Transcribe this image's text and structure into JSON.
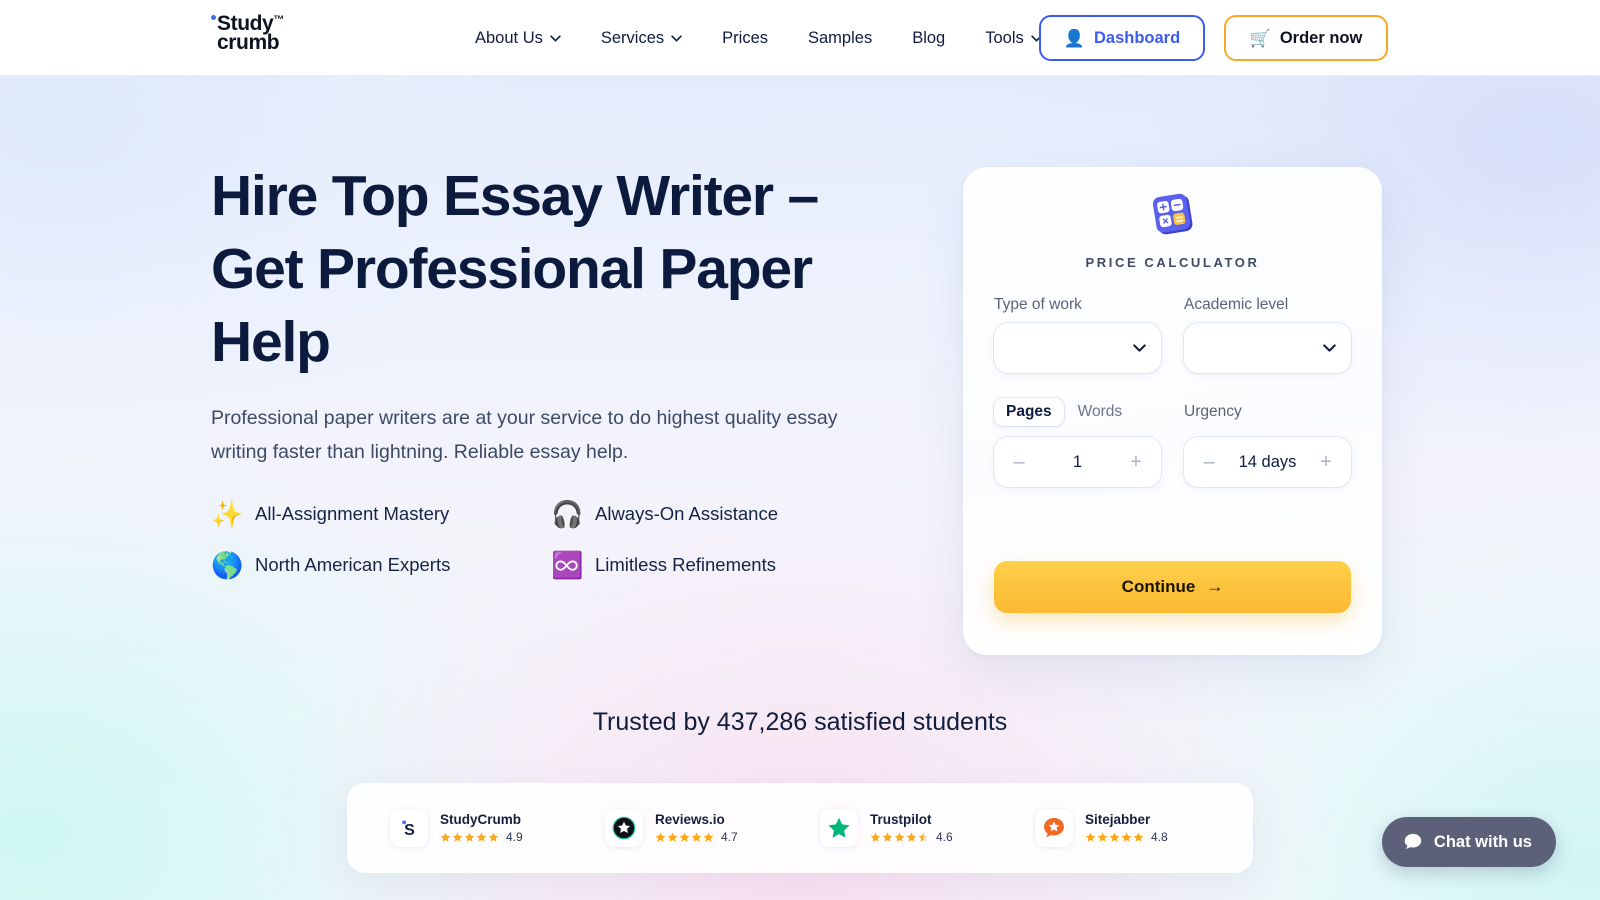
{
  "header": {
    "logo": {
      "line1": "Study",
      "tm": "™",
      "line2": "crumb"
    },
    "nav": [
      {
        "label": "About Us",
        "caret": true
      },
      {
        "label": "Services",
        "caret": true
      },
      {
        "label": "Prices",
        "caret": false
      },
      {
        "label": "Samples",
        "caret": false
      },
      {
        "label": "Blog",
        "caret": false
      },
      {
        "label": "Tools",
        "caret": true
      }
    ],
    "dashboard_button": {
      "label": "Dashboard",
      "icon": "user-icon",
      "glyph": "👤",
      "accent": "#3b5bf5"
    },
    "order_button": {
      "label": "Order now",
      "icon": "shopping-cart-icon",
      "glyph": "🛒",
      "accent": "#f9a825"
    }
  },
  "hero": {
    "heading": "Hire Top Essay Writer – Get Professional Paper Help",
    "paragraph": "Professional paper writers are at your service to do highest quality essay writing faster than lightning. Reliable essay help.",
    "features": [
      {
        "glyph": "✨",
        "icon": "sparkles-icon",
        "label": "All-Assignment Mastery"
      },
      {
        "glyph": "🎧",
        "icon": "headphones-icon",
        "label": "Always-On Assistance"
      },
      {
        "glyph": "🌎",
        "icon": "globe-americas-icon",
        "label": "North American Experts"
      },
      {
        "glyph": "♾️",
        "icon": "infinity-icon",
        "label": "Limitless Refinements"
      }
    ]
  },
  "calculator": {
    "icon": "calculator-icon",
    "title": "PRICE CALCULATOR",
    "type_of_work": {
      "label": "Type of work",
      "value": "",
      "placeholder": ""
    },
    "academic_level": {
      "label": "Academic level",
      "value": "",
      "placeholder": ""
    },
    "unit_tabs": [
      {
        "label": "Pages",
        "active": true
      },
      {
        "label": "Words",
        "active": false
      }
    ],
    "amount": {
      "value": "1",
      "minus": "–",
      "plus": "+"
    },
    "urgency": {
      "label": "Urgency",
      "value": "14 days",
      "minus": "–",
      "plus": "+"
    },
    "continue_button": {
      "label": "Continue",
      "arrow": "→",
      "color": "#fcc23c"
    }
  },
  "trust": {
    "title": "Trusted by 437,286 satisfied students",
    "items": [
      {
        "name": "StudyCrumb",
        "score": "4.9",
        "stars": 5,
        "half": false,
        "logo": "studycrumb-logo"
      },
      {
        "name": "Reviews.io",
        "score": "4.7",
        "stars": 5,
        "half": false,
        "logo": "reviewsio-logo"
      },
      {
        "name": "Trustpilot",
        "score": "4.6",
        "stars": 4,
        "half": true,
        "logo": "trustpilot-logo"
      },
      {
        "name": "Sitejabber",
        "score": "4.8",
        "stars": 5,
        "half": false,
        "logo": "sitejabber-logo"
      }
    ]
  },
  "chat": {
    "label": "Chat with us",
    "icon": "chat-bubble-icon"
  }
}
